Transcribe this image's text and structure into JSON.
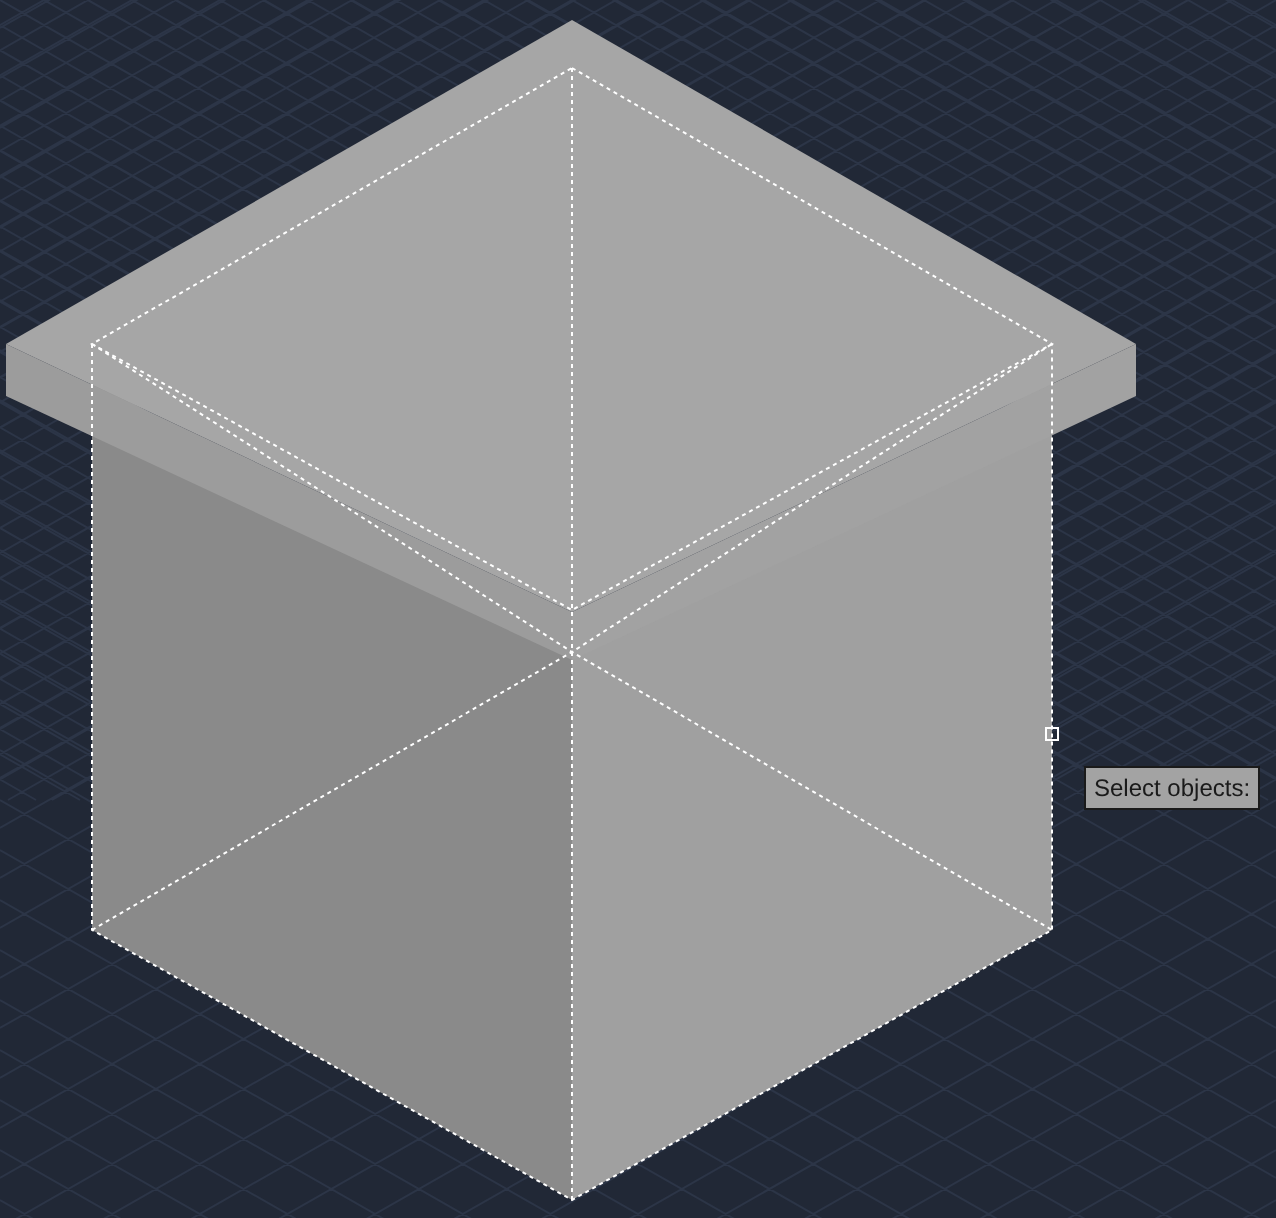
{
  "solid": {
    "selected": true
  },
  "tooltip": {
    "text": "Select objects:"
  }
}
